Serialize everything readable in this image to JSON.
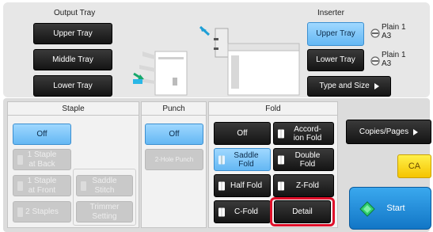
{
  "output_tray": {
    "title": "Output Tray",
    "buttons": [
      {
        "label": "Upper Tray",
        "selected": false
      },
      {
        "label": "Middle Tray",
        "selected": false
      },
      {
        "label": "Lower Tray",
        "selected": false
      }
    ]
  },
  "inserter": {
    "title": "Inserter",
    "upper_label": "Upper Tray",
    "lower_label": "Lower Tray",
    "type_size_label": "Type and Size",
    "upper_paper_type": "Plain 1",
    "upper_paper_size": "A3",
    "lower_paper_type": "Plain 1",
    "lower_paper_size": "A3"
  },
  "staple": {
    "header": "Staple",
    "off_label": "Off",
    "one_back_label": "1 Staple\nat Back",
    "one_front_label": "1 Staple\nat Front",
    "two_staples_label": "2 Staples",
    "saddle_stitch_label": "Saddle\nStitch",
    "trimmer_label": "Trimmer\nSetting"
  },
  "punch": {
    "header": "Punch",
    "off_label": "Off",
    "two_hole_label": "2-Hole Punch"
  },
  "fold": {
    "header": "Fold",
    "off_label": "Off",
    "accordion_label": "Accord-\nion Fold",
    "saddle_label": "Saddle\nFold",
    "double_label": "Double\nFold",
    "half_label": "Half Fold",
    "z_label": "Z-Fold",
    "c_label": "C-Fold",
    "detail_label": "Detail"
  },
  "right": {
    "copies_pages_label": "Copies/Pages",
    "ca_label": "CA",
    "start_label": "Start"
  },
  "colors": {
    "highlight": "#e0102a",
    "selected": "#7cc4f8",
    "start": "#1a86d6",
    "ca": "#ffd400"
  }
}
